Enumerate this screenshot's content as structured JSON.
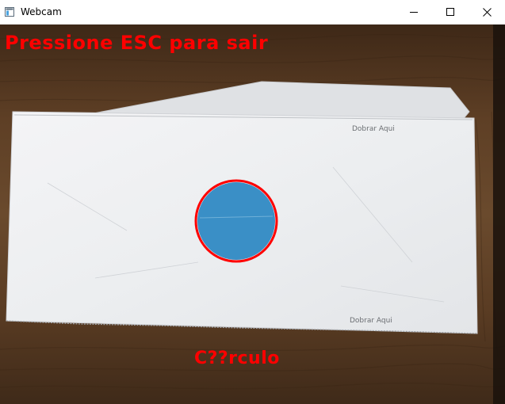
{
  "window": {
    "title": "Webcam",
    "controls": {
      "minimize_icon": "minimize-icon",
      "maximize_icon": "maximize-icon",
      "close_icon": "close-icon"
    }
  },
  "overlay": {
    "exit_hint": "Pressione ESC para sair",
    "shape_label": "C??rculo",
    "text_color": "#ff0000"
  },
  "scene": {
    "envelope_print_top": "Dobrar Aqui",
    "envelope_print_bottom": "Dobrar Aqui",
    "detected_shape": "circle",
    "circle_fill_color": "#3a8fc6",
    "circle_outline_color": "#ff0000",
    "table_color": "#5a3a22"
  }
}
